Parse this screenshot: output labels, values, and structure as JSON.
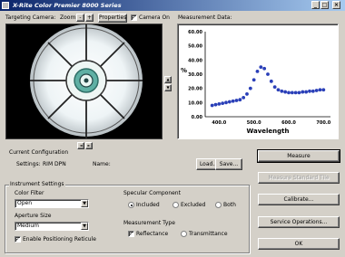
{
  "window": {
    "title": "X-Rite Color Premier 8000 Series",
    "minimize_glyph": "_",
    "maximize_glyph": "□",
    "close_glyph": "×"
  },
  "toolbar": {
    "targeting_camera_label": "Targeting Camera:",
    "zoom_label": "Zoom:",
    "zoom_minus": "-",
    "zoom_plus": "+",
    "properties_label": "Properties",
    "camera_on_label": "Camera On",
    "camera_on_checked": true,
    "measurement_data_label": "Measurement Data:"
  },
  "camera_nav": {
    "up_glyph": "▲",
    "down_glyph": "▼",
    "left_glyph": "◄",
    "right_glyph": "►"
  },
  "config": {
    "title": "Current Configuration",
    "settings_label": "Settings:",
    "settings_value": "RIM DPN",
    "name_label": "Name:",
    "load_label": "Load...",
    "save_label": "Save..."
  },
  "actions": {
    "measure_label": "Measure",
    "disabled_label": "Measure Standard Tile",
    "calibrate_label": "Calibrate...",
    "service_label": "Service Operations...",
    "ok_label": "OK"
  },
  "instrument": {
    "title": "Instrument Settings",
    "color_filter_label": "Color Filter",
    "color_filter_value": "Open",
    "aperture_label": "Aperture Size",
    "aperture_value": "Medium",
    "positioning_label": "Enable Positioning Reticule",
    "positioning_checked": true,
    "specular_title": "Specular Component",
    "specular_options": [
      "Included",
      "Excluded",
      "Both"
    ],
    "specular_selected": 0,
    "measurement_type_title": "Measurement Type",
    "measurement_type_options": [
      "Reflectance",
      "Transmittance"
    ],
    "measurement_type_selected": 0
  },
  "colors": {
    "title_start": "#0a246a",
    "title_end": "#a6caf0",
    "series": "#2a3fb8",
    "face": "#d4d0c8"
  },
  "chart_data": {
    "type": "scatter",
    "xlabel": "Wavelength",
    "ylabel": "%",
    "xlim": [
      360,
      720
    ],
    "ylim": [
      0,
      60
    ],
    "xticks": [
      "400.0",
      "500.0",
      "600.0",
      "700.0"
    ],
    "yticks": [
      "60.00",
      "50.00",
      "40.00",
      "30.00",
      "20.00",
      "10.00",
      "0.00"
    ],
    "grid": false,
    "series": [
      {
        "x": [
          380,
          390,
          400,
          410,
          420,
          430,
          440,
          450,
          460,
          470,
          480,
          490,
          500,
          510,
          520,
          530,
          540,
          550,
          560,
          570,
          580,
          590,
          600,
          610,
          620,
          630,
          640,
          650,
          660,
          670,
          680,
          690,
          700
        ],
        "values": [
          8,
          8.5,
          9,
          9.5,
          10,
          10.5,
          11,
          11.5,
          12,
          13.5,
          16,
          20,
          26,
          32,
          35,
          34,
          30,
          25,
          21,
          19,
          18,
          17.5,
          17,
          17,
          17,
          17,
          17.5,
          17.5,
          18,
          18,
          18.5,
          19,
          19
        ]
      }
    ]
  }
}
